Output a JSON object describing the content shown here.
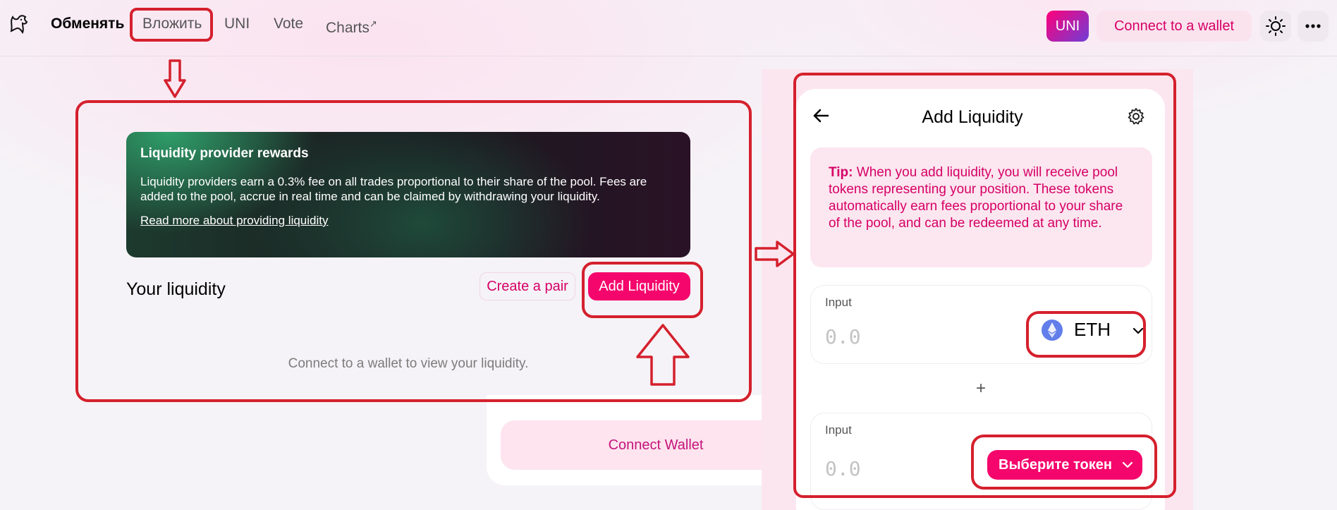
{
  "header": {
    "nav": {
      "swap": "Обменять",
      "pool": "Вложить",
      "uni": "UNI",
      "vote": "Vote",
      "charts": "Charts",
      "charts_suffix": "↗"
    },
    "uni_badge": "UNI",
    "connect_wallet": "Connect to a wallet"
  },
  "rewards": {
    "title": "Liquidity provider rewards",
    "body": "Liquidity providers earn a 0.3% fee on all trades proportional to their share of the pool. Fees are added to the pool, accrue in real time and can be claimed by withdrawing your liquidity.",
    "link": "Read more about providing liquidity"
  },
  "your_liquidity": {
    "title": "Your liquidity",
    "create_pair": "Create a pair",
    "add_liquidity": "Add Liquidity",
    "connect_message": "Connect to a wallet to view your liquidity."
  },
  "background_card": {
    "connect_wallet": "Connect Wallet"
  },
  "add_panel": {
    "title": "Add Liquidity",
    "tip_label": "Tip:",
    "tip_text": " When you add liquidity, you will receive pool tokens representing your position. These tokens automatically earn fees proportional to your share of the pool, and can be redeemed at any time.",
    "input1": {
      "label": "Input",
      "value": "0.0",
      "token": "ETH"
    },
    "plus": "+",
    "input2": {
      "label": "Input",
      "value": "0.0",
      "token_button": "Выберите токен"
    }
  },
  "colors": {
    "accent": "#f5066c",
    "accent_text": "#d50066",
    "annotation": "#d5202d"
  }
}
